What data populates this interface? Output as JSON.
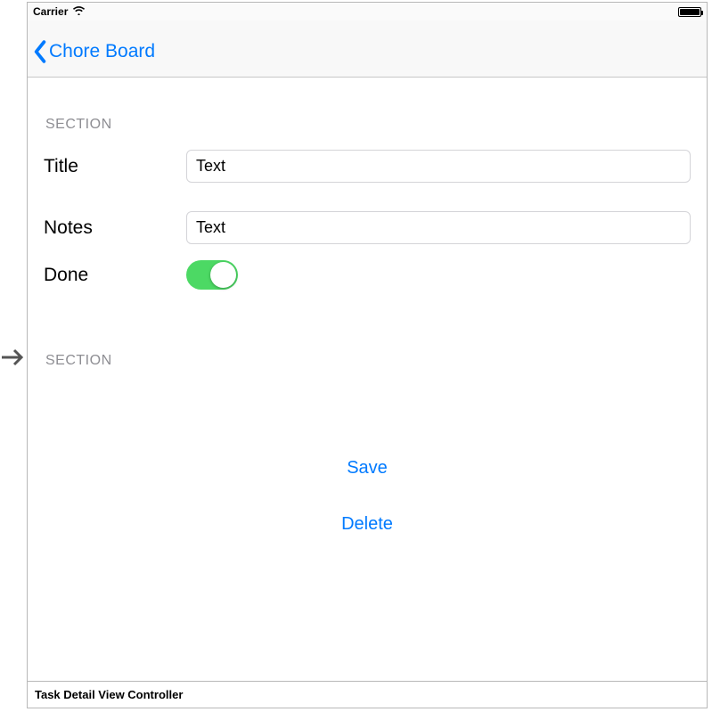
{
  "status": {
    "carrier": "Carrier"
  },
  "nav": {
    "back_label": "Chore Board"
  },
  "section1": {
    "header": "SECTION",
    "title_label": "Title",
    "title_value": "Text",
    "notes_label": "Notes",
    "notes_value": "Text",
    "done_label": "Done",
    "done_on": true
  },
  "section2": {
    "header": "SECTION",
    "save_label": "Save",
    "delete_label": "Delete"
  },
  "scene_name": "Task Detail View Controller",
  "colors": {
    "tint": "#007aff",
    "toggle_on": "#4cd964",
    "section_header": "#8e8e93"
  }
}
